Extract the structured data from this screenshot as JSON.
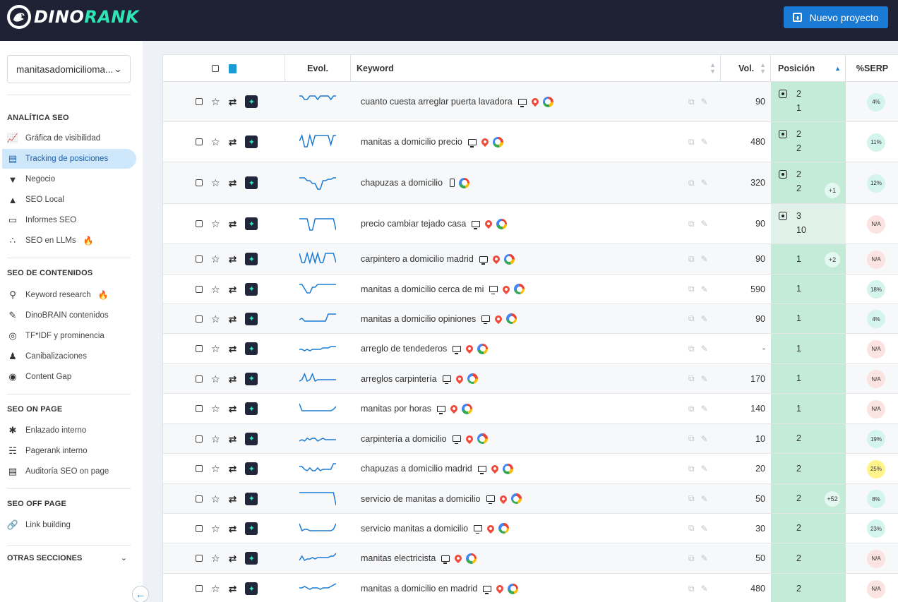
{
  "header": {
    "logo_dino": "DINO",
    "logo_rank": "RANK",
    "new_project_label": "Nuevo proyecto"
  },
  "sidebar": {
    "project": "manitasadomicilioma...",
    "sections": [
      {
        "title": "ANALÍTICA SEO",
        "items": [
          {
            "label": "Gráfica de visibilidad",
            "icon": "chart-search-icon"
          },
          {
            "label": "Tracking de posiciones",
            "icon": "bar-chart-icon",
            "active": true
          },
          {
            "label": "Negocio",
            "icon": "funnel-icon"
          },
          {
            "label": "SEO Local",
            "icon": "map-icon"
          },
          {
            "label": "Informes SEO",
            "icon": "pdf-icon"
          },
          {
            "label": "SEO en LLMs",
            "icon": "dots-icon",
            "flame": true
          }
        ]
      },
      {
        "title": "SEO DE CONTENIDOS",
        "items": [
          {
            "label": "Keyword research",
            "icon": "keyword-search-icon",
            "flame": true
          },
          {
            "label": "DinoBRAIN contenidos",
            "icon": "pen-icon"
          },
          {
            "label": "TF*IDF y prominencia",
            "icon": "target-icon"
          },
          {
            "label": "Canibalizaciones",
            "icon": "cannibal-icon"
          },
          {
            "label": "Content Gap",
            "icon": "eye-icon"
          }
        ]
      },
      {
        "title": "SEO ON PAGE",
        "items": [
          {
            "label": "Enlazado interno",
            "icon": "network-icon"
          },
          {
            "label": "Pagerank interno",
            "icon": "hierarchy-icon"
          },
          {
            "label": "Auditoría SEO on page",
            "icon": "audit-icon"
          }
        ]
      },
      {
        "title": "SEO OFF PAGE",
        "items": [
          {
            "label": "Link building",
            "icon": "link-icon"
          }
        ]
      }
    ],
    "other_sections": "OTRAS SECCIONES"
  },
  "table": {
    "headers": {
      "evol": "Evol.",
      "keyword": "Keyword",
      "vol": "Vol.",
      "pos": "Posición",
      "serp": "%SERP"
    },
    "rows": [
      {
        "keyword": "cuanto cuesta arreglar puerta lavadora",
        "device": "desktop",
        "pin": true,
        "vol": "90",
        "pos": "2",
        "pos2": "1",
        "feat": true,
        "delta": "",
        "serp": "4%",
        "serp_type": "green",
        "spark": [
          3,
          3,
          8,
          8,
          3,
          3,
          3,
          8,
          3,
          3,
          3,
          3,
          8,
          3,
          3
        ],
        "tall": true
      },
      {
        "keyword": "manitas a domicilio precio",
        "device": "desktop",
        "pin": true,
        "vol": "480",
        "pos": "2",
        "pos2": "2",
        "feat": true,
        "delta": "",
        "serp": "11%",
        "serp_type": "green",
        "spark": [
          10,
          2,
          18,
          18,
          2,
          15,
          2,
          2,
          2,
          2,
          2,
          2,
          15,
          2,
          2
        ],
        "tall": true
      },
      {
        "keyword": "chapuzas a domicilio",
        "device": "mobile",
        "pin": false,
        "vol": "320",
        "pos": "2",
        "pos2": "2",
        "feat": true,
        "delta": "+1",
        "serp": "12%",
        "serp_type": "green",
        "spark": [
          4,
          4,
          4,
          8,
          8,
          12,
          12,
          20,
          20,
          8,
          8,
          6,
          6,
          4,
          4
        ],
        "tall": true
      },
      {
        "keyword": "precio cambiar tejado casa",
        "device": "desktop",
        "pin": true,
        "vol": "90",
        "pos": "3",
        "pos2": "10",
        "feat": true,
        "delta": "",
        "serp": "N/A",
        "serp_type": "na",
        "spark": [
          4,
          4,
          4,
          4,
          20,
          20,
          4,
          4,
          4,
          4,
          4,
          4,
          4,
          4,
          20
        ],
        "tall": true,
        "light": true
      },
      {
        "keyword": "carpintero a domicilio madrid",
        "device": "desktop",
        "pin": true,
        "vol": "90",
        "pos": "1",
        "pos2": "",
        "feat": false,
        "delta": "+2",
        "serp": "N/A",
        "serp_type": "na",
        "spark": [
          3,
          16,
          16,
          3,
          16,
          3,
          16,
          3,
          16,
          16,
          3,
          3,
          3,
          3,
          16
        ]
      },
      {
        "keyword": "manitas a domicilio cerca de mi",
        "device": "desktop",
        "pin": true,
        "vol": "590",
        "pos": "1",
        "pos2": "",
        "feat": false,
        "delta": "",
        "serp": "18%",
        "serp_type": "green",
        "spark": [
          4,
          4,
          10,
          16,
          16,
          8,
          8,
          4,
          4,
          4,
          4,
          4,
          4,
          4,
          4
        ]
      },
      {
        "keyword": "manitas a domicilio opiniones",
        "device": "desktop",
        "pin": true,
        "vol": "90",
        "pos": "1",
        "pos2": "",
        "feat": false,
        "delta": "",
        "serp": "4%",
        "serp_type": "green",
        "spark": [
          12,
          10,
          14,
          14,
          14,
          14,
          14,
          14,
          14,
          14,
          14,
          4,
          4,
          4,
          4
        ]
      },
      {
        "keyword": "arreglo de tendederos",
        "device": "desktop",
        "pin": true,
        "vol": "-",
        "pos": "1",
        "pos2": "",
        "feat": false,
        "delta": "",
        "serp": "N/A",
        "serp_type": "na",
        "spark": [
          12,
          12,
          14,
          12,
          14,
          12,
          12,
          12,
          12,
          10,
          10,
          10,
          8,
          8,
          8
        ]
      },
      {
        "keyword": "arreglos carpintería",
        "device": "desktop",
        "pin": true,
        "vol": "170",
        "pos": "1",
        "pos2": "",
        "feat": false,
        "delta": "",
        "serp": "N/A",
        "serp_type": "na",
        "spark": [
          14,
          12,
          4,
          14,
          12,
          4,
          14,
          12,
          12,
          12,
          12,
          12,
          12,
          12,
          12
        ]
      },
      {
        "keyword": "manitas por horas",
        "device": "desktop",
        "pin": true,
        "vol": "140",
        "pos": "1",
        "pos2": "",
        "feat": false,
        "delta": "",
        "serp": "N/A",
        "serp_type": "na",
        "spark": [
          4,
          14,
          14,
          14,
          14,
          14,
          14,
          14,
          14,
          14,
          14,
          14,
          14,
          12,
          8
        ]
      },
      {
        "keyword": "carpintería a domicilio",
        "device": "desktop",
        "pin": true,
        "vol": "10",
        "pos": "2",
        "pos2": "",
        "feat": false,
        "delta": "",
        "serp": "19%",
        "serp_type": "green",
        "spark": [
          14,
          12,
          14,
          10,
          12,
          10,
          10,
          14,
          12,
          10,
          12,
          12,
          12,
          12,
          12
        ]
      },
      {
        "keyword": "chapuzas a domicilio madrid",
        "device": "desktop",
        "pin": true,
        "vol": "20",
        "pos": "2",
        "pos2": "",
        "feat": false,
        "delta": "",
        "serp": "25%",
        "serp_type": "yellow",
        "spark": [
          8,
          8,
          12,
          14,
          10,
          14,
          14,
          10,
          14,
          12,
          12,
          12,
          12,
          4,
          4
        ]
      },
      {
        "keyword": "servicio de manitas a domicilio",
        "device": "desktop",
        "pin": true,
        "vol": "50",
        "pos": "2",
        "pos2": "",
        "feat": false,
        "delta": "+52",
        "serp": "8%",
        "serp_type": "green",
        "spark": [
          2,
          2,
          2,
          2,
          2,
          2,
          2,
          2,
          2,
          2,
          2,
          2,
          2,
          2,
          20
        ]
      },
      {
        "keyword": "servicio manitas a domicilio",
        "device": "desktop",
        "pin": true,
        "vol": "30",
        "pos": "2",
        "pos2": "",
        "feat": false,
        "delta": "",
        "serp": "23%",
        "serp_type": "green",
        "spark": [
          4,
          14,
          12,
          12,
          14,
          14,
          14,
          14,
          14,
          14,
          14,
          14,
          14,
          12,
          4
        ]
      },
      {
        "keyword": "manitas electricista",
        "device": "desktop",
        "pin": true,
        "vol": "50",
        "pos": "2",
        "pos2": "",
        "feat": false,
        "delta": "",
        "serp": "N/A",
        "serp_type": "na",
        "spark": [
          14,
          8,
          14,
          12,
          12,
          10,
          12,
          10,
          10,
          10,
          10,
          10,
          8,
          8,
          4
        ]
      },
      {
        "keyword": "manitas a domicilio en madrid",
        "device": "desktop",
        "pin": true,
        "vol": "480",
        "pos": "2",
        "pos2": "",
        "feat": false,
        "delta": "",
        "serp": "N/A",
        "serp_type": "na",
        "spark": [
          10,
          10,
          8,
          10,
          12,
          10,
          10,
          10,
          12,
          10,
          10,
          10,
          8,
          6,
          4
        ]
      }
    ]
  },
  "colors": {
    "accent": "#1a7bd4",
    "sparkline": "#1a7bd4",
    "position_bg": "#c4ebd8",
    "brand_green": "#2ee5b5"
  }
}
